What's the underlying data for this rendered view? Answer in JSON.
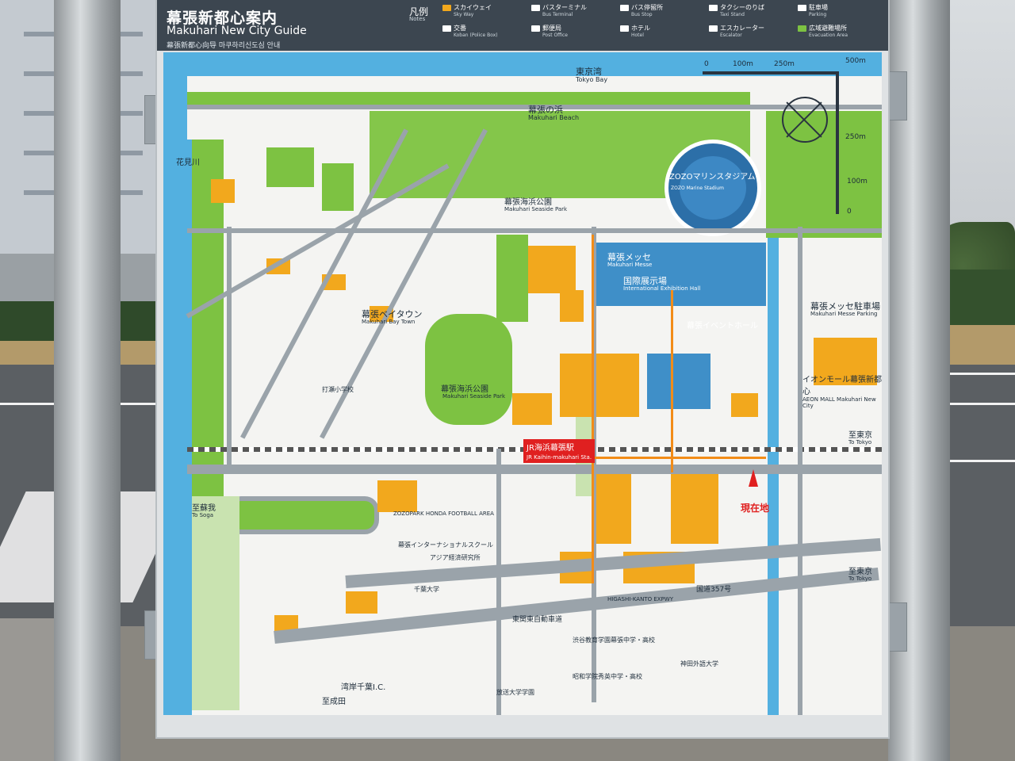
{
  "header": {
    "title_ja": "幕張新都心案内",
    "title_en": "Makuhari New City Guide",
    "title_zh_ko": "幕張新都心向导 마쿠하리신도심 안내"
  },
  "legend": {
    "title": "凡例",
    "subtitle": "Notes",
    "items": [
      {
        "label": "スカイウェイ",
        "sub": "Sky Way",
        "color": "#f2a81d"
      },
      {
        "label": "バスターミナル",
        "sub": "Bus Terminal",
        "color": "#ffffff"
      },
      {
        "label": "バス停留所",
        "sub": "Bus Stop",
        "color": "#ffffff"
      },
      {
        "label": "タクシーのりば",
        "sub": "Taxi Stand",
        "color": "#ffffff"
      },
      {
        "label": "駐車場",
        "sub": "Parking",
        "color": "#ffffff"
      },
      {
        "label": "交番",
        "sub": "Koban (Police Box)",
        "color": "#ffffff"
      },
      {
        "label": "郵便局",
        "sub": "Post Office",
        "color": "#ffffff"
      },
      {
        "label": "ホテル",
        "sub": "Hotel",
        "color": "#ffffff"
      },
      {
        "label": "エスカレーター",
        "sub": "Escalator",
        "color": "#ffffff"
      },
      {
        "label": "広域避難場所",
        "sub": "Evacuation Area",
        "color": "#7dc242"
      }
    ]
  },
  "map": {
    "sea_ja": "東京湾",
    "sea_en": "Tokyo Bay",
    "beach_ja": "幕張の浜",
    "beach_en": "Makuhari Beach",
    "stadium_ja": "ZOZOマリンスタジアム",
    "stadium_en": "ZOZO Marine Stadium",
    "park_ja": "幕張海浜公園",
    "park_en": "Makuhari Seaside Park",
    "messe_ja": "幕張メッセ",
    "messe_en": "Makuhari Messe",
    "expo_ja": "国際展示場",
    "expo_en": "International Exhibition Hall",
    "event_hall_ja": "幕張イベントホール",
    "bay_town_ja": "幕張ベイタウン",
    "bay_town_en": "Makuhari Bay Town",
    "messe_parking_ja": "幕張メッセ駐車場",
    "messe_parking_en": "Makuhari Messe Parking",
    "aeon_ja": "イオンモール幕張新都心",
    "aeon_en": "AEON MALL Makuhari New City",
    "station_ja": "JR海浜幕張駅",
    "station_en": "JR Kaihin-makuhari Sta.",
    "here_label": "現在地",
    "to_tokyo_ja": "至東京",
    "to_tokyo_en": "To Tokyo",
    "to_soga_ja": "至蘇我",
    "to_soga_en": "To Soga",
    "to_narita_ja": "至成田",
    "river_ja": "花見川",
    "football_area": "ZOZOPARK HONDA FOOTBALL AREA",
    "route_357": "国道357号",
    "expressway_ja": "東関東自動車道",
    "expressway_en": "HIGASHI-KANTO EXPWY",
    "ic_ja": "湾岸千葉I.C.",
    "intl_school": "幕張インターナショナルスクール",
    "asia_economy": "アジア経済研究所",
    "chiba_university": "千葉大学",
    "kanda_univ": "神田外語大学",
    "open_univ": "放送大学学園",
    "shibuya_school": "渋谷教育学園幕張中学・高校",
    "showa_school": "昭和学院秀英中学・高校",
    "uchibori": "打瀬小学校",
    "scale_labels": [
      "0",
      "100m",
      "250m",
      "500m"
    ],
    "scale_v_labels": [
      "250m",
      "100m",
      "0"
    ]
  }
}
